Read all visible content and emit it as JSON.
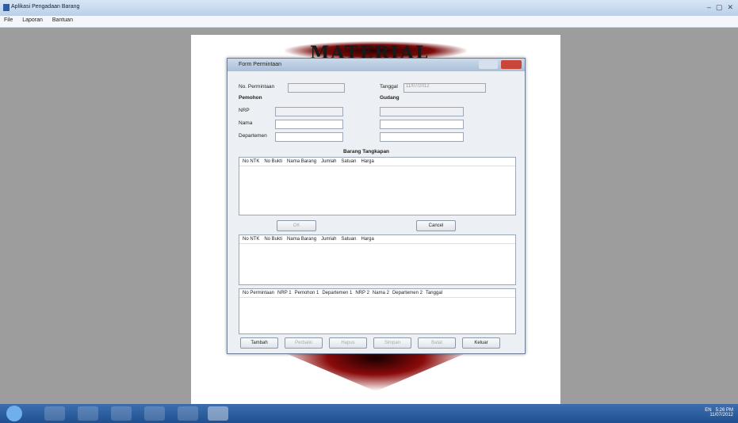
{
  "window": {
    "title": "Aplikasi Pengadaan Barang",
    "center_title": "",
    "controls": [
      "–",
      "▢",
      "✕"
    ]
  },
  "menu": [
    "File",
    "Laporan",
    "Bantuan"
  ],
  "canvas": {
    "watermark": "MATERIAL"
  },
  "dialog": {
    "title": "Form Permintaan",
    "no_permintaan_label": "No. Permintaan",
    "tanggal_label": "Tanggal",
    "tanggal_value": "11/07/2012",
    "pemohon_label": "Pemohon",
    "gudang_label": "Gudang",
    "nrp_label": "NRP",
    "nama_label": "Nama",
    "departemen_label": "Departemen",
    "section_title": "Barang Tangkapan",
    "grid1_columns": [
      "No NTK",
      "No Bukti",
      "Nama Barang",
      "Jumlah",
      "Satuan",
      "Harga"
    ],
    "grid2_columns": [
      "No NTK",
      "No Bukti",
      "Nama Barang",
      "Jumlah",
      "Satuan",
      "Harga"
    ],
    "grid3_columns": [
      "No Permintaan",
      "NRP 1",
      "Pemohon 1",
      "Departemen 1",
      "NRP 2",
      "Nama 2",
      "Departemen 2",
      "Tanggal"
    ],
    "ok_label": "OK",
    "cancel_label": "Cancel",
    "buttons": [
      "Tambah",
      "Perbaiki",
      "Hapus",
      "Simpan",
      "Batal",
      "Keluar"
    ]
  },
  "taskbar": {
    "lang": "EN",
    "time": "5:26 PM",
    "date": "11/07/2012"
  }
}
